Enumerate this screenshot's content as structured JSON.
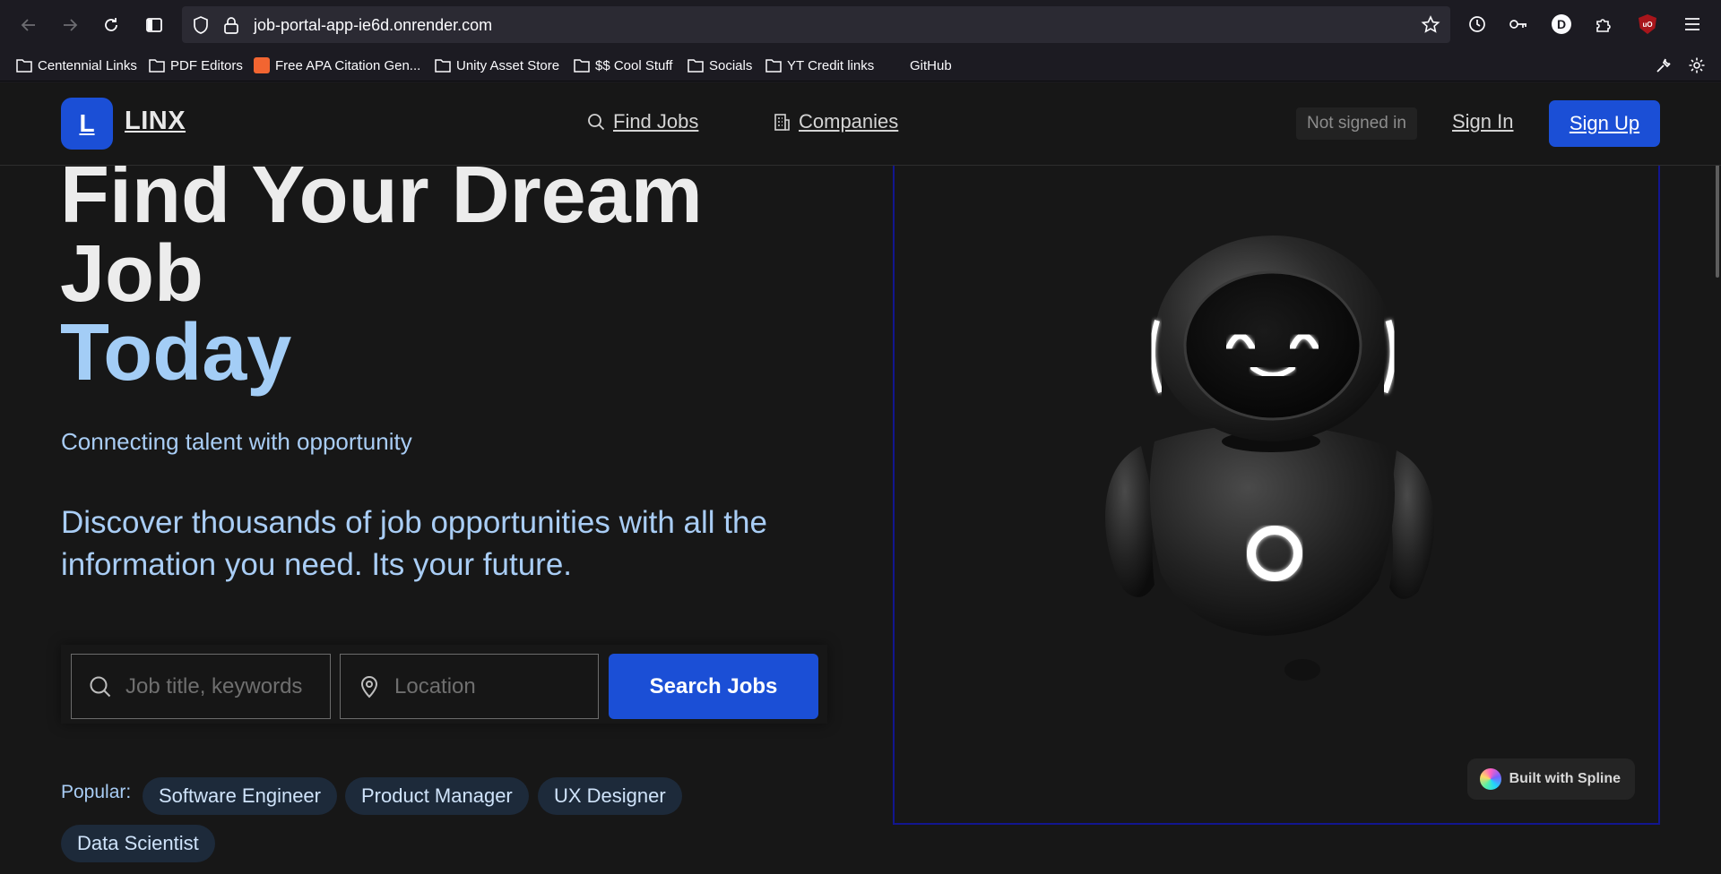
{
  "browser": {
    "url": "job-portal-app-ie6d.onrender.com",
    "bookmarks": [
      {
        "label": "Centennial Links",
        "icon": "folder-icon"
      },
      {
        "label": "PDF Editors",
        "icon": "folder-icon"
      },
      {
        "label": "Free APA Citation Gen...",
        "icon": "apa-favicon"
      },
      {
        "label": "Unity Asset Store",
        "icon": "folder-icon"
      },
      {
        "label": "$$ Cool Stuff",
        "icon": "folder-icon"
      },
      {
        "label": "Socials",
        "icon": "folder-icon"
      },
      {
        "label": "YT Credit links",
        "icon": "folder-icon"
      },
      {
        "label": "GitHub",
        "icon": "none"
      }
    ],
    "profile_initial": "D",
    "ublock_label": "uO"
  },
  "site": {
    "logo_letter": "L",
    "logo_text": "LINX",
    "nav": {
      "find_jobs": "Find Jobs",
      "companies": "Companies"
    },
    "auth": {
      "status": "Not signed in",
      "sign_in": "Sign In",
      "sign_up": "Sign Up"
    }
  },
  "hero": {
    "title_line1": "Find Your Dream",
    "title_line2": "Job",
    "title_line3": "Today",
    "tagline": "Connecting talent with opportunity",
    "description": "Discover thousands of job opportunities with all the information you need. Its your future."
  },
  "search": {
    "keywords_placeholder": "Job title, keywords",
    "location_placeholder": "Location",
    "button_label": "Search Jobs"
  },
  "popular": {
    "label": "Popular:",
    "tags": [
      "Software Engineer",
      "Product Manager",
      "UX Designer",
      "Data Scientist"
    ]
  },
  "spline": {
    "badge": "Built with Spline"
  },
  "colors": {
    "accent": "#1b4fd6",
    "highlight": "#a3cdf6",
    "background": "#171717"
  }
}
